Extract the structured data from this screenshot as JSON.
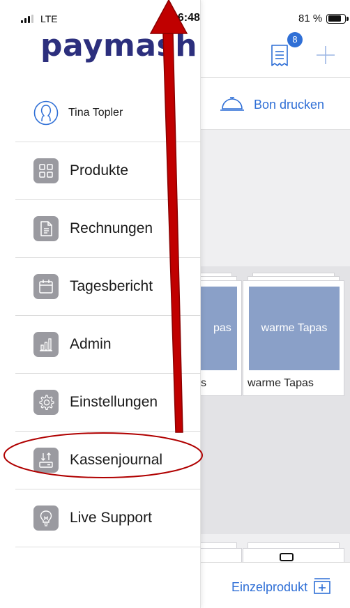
{
  "status_bar": {
    "carrier": "LTE",
    "time": "16:48",
    "battery_percent": "81 %"
  },
  "brand": {
    "logo_text": "paymash"
  },
  "header": {
    "receipt_badge_count": "8",
    "receipt_icon": "receipt-icon",
    "add_icon": "plus-icon"
  },
  "toolbar": {
    "print_label": "Bon drucken",
    "print_icon": "service-bell-icon"
  },
  "drawer": {
    "user": {
      "name": "Tina Topler",
      "icon": "user-avatar-icon"
    },
    "items": [
      {
        "label": "Produkte",
        "icon": "grid-icon"
      },
      {
        "label": "Rechnungen",
        "icon": "document-icon"
      },
      {
        "label": "Tagesbericht",
        "icon": "calendar-icon"
      },
      {
        "label": "Admin",
        "icon": "bar-chart-icon"
      },
      {
        "label": "Einstellungen",
        "icon": "gear-icon"
      },
      {
        "label": "Kassenjournal",
        "icon": "cash-register-icon"
      },
      {
        "label": "Live Support",
        "icon": "lightbulb-icon"
      }
    ]
  },
  "products": [
    {
      "image_text": "pas",
      "name": "s"
    },
    {
      "image_text": "warme Tapas",
      "name": "warme Tapas"
    }
  ],
  "footer": {
    "single_product_label": "Einzelprodukt"
  },
  "colors": {
    "accent": "#2f6fd6",
    "brand": "#2c2f7d",
    "tile_image": "#8aa0c8",
    "annotation": "#b00000"
  }
}
